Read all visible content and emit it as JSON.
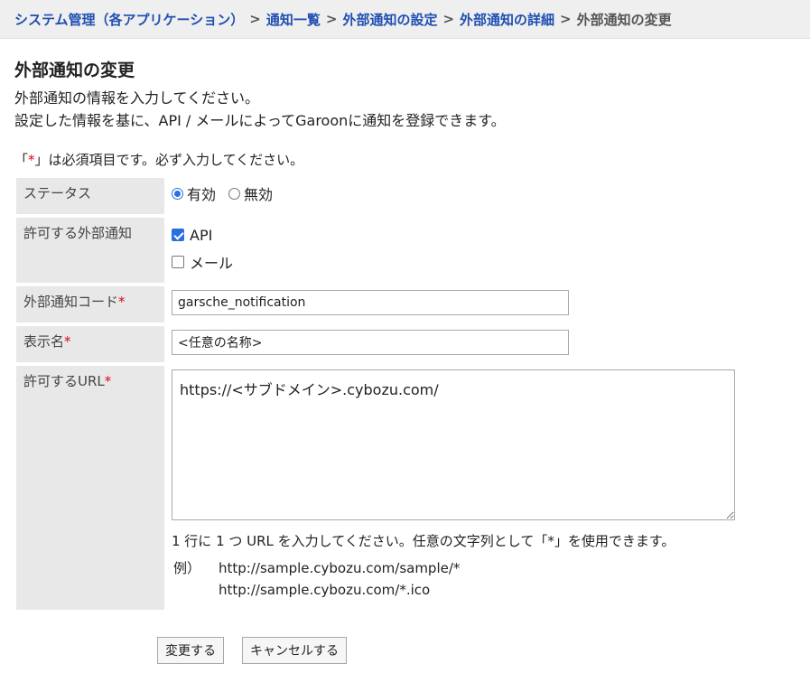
{
  "breadcrumb": {
    "items": [
      "システム管理（各アプリケーション）",
      "通知一覧",
      "外部通知の設定",
      "外部通知の詳細"
    ],
    "current": "外部通知の変更",
    "separator": ">"
  },
  "page": {
    "title": "外部通知の変更",
    "desc1": "外部通知の情報を入力してください。",
    "desc2": "設定した情報を基に、API / メールによってGaroonに通知を登録できます。",
    "required_prefix": "「",
    "required_star": "*",
    "required_suffix": "」は必須項目です。必ず入力してください。"
  },
  "form": {
    "status": {
      "label": "ステータス",
      "options": [
        {
          "label": "有効",
          "selected": true
        },
        {
          "label": "無効",
          "selected": false
        }
      ]
    },
    "allowed": {
      "label": "許可する外部通知",
      "options": [
        {
          "label": "API",
          "checked": true
        },
        {
          "label": "メール",
          "checked": false
        }
      ]
    },
    "code": {
      "label": "外部通知コード",
      "star": "*",
      "value": "garsche_notification"
    },
    "display_name": {
      "label": "表示名",
      "star": "*",
      "value": "<任意の名称>"
    },
    "url": {
      "label": "許可するURL",
      "star": "*",
      "value": "https://<サブドメイン>.cybozu.com/",
      "hint": "1 行に 1 つ URL を入力してください。任意の文字列として「*」を使用できます。",
      "example_label": "例）",
      "examples": [
        "http://sample.cybozu.com/sample/*",
        "http://sample.cybozu.com/*.ico"
      ]
    }
  },
  "buttons": {
    "submit": "変更する",
    "cancel": "キャンセルする"
  },
  "colors": {
    "link": "#1f4fb2",
    "required": "#e0001b",
    "accent": "#2a6fe0",
    "label_bg": "#e8e8e8"
  }
}
